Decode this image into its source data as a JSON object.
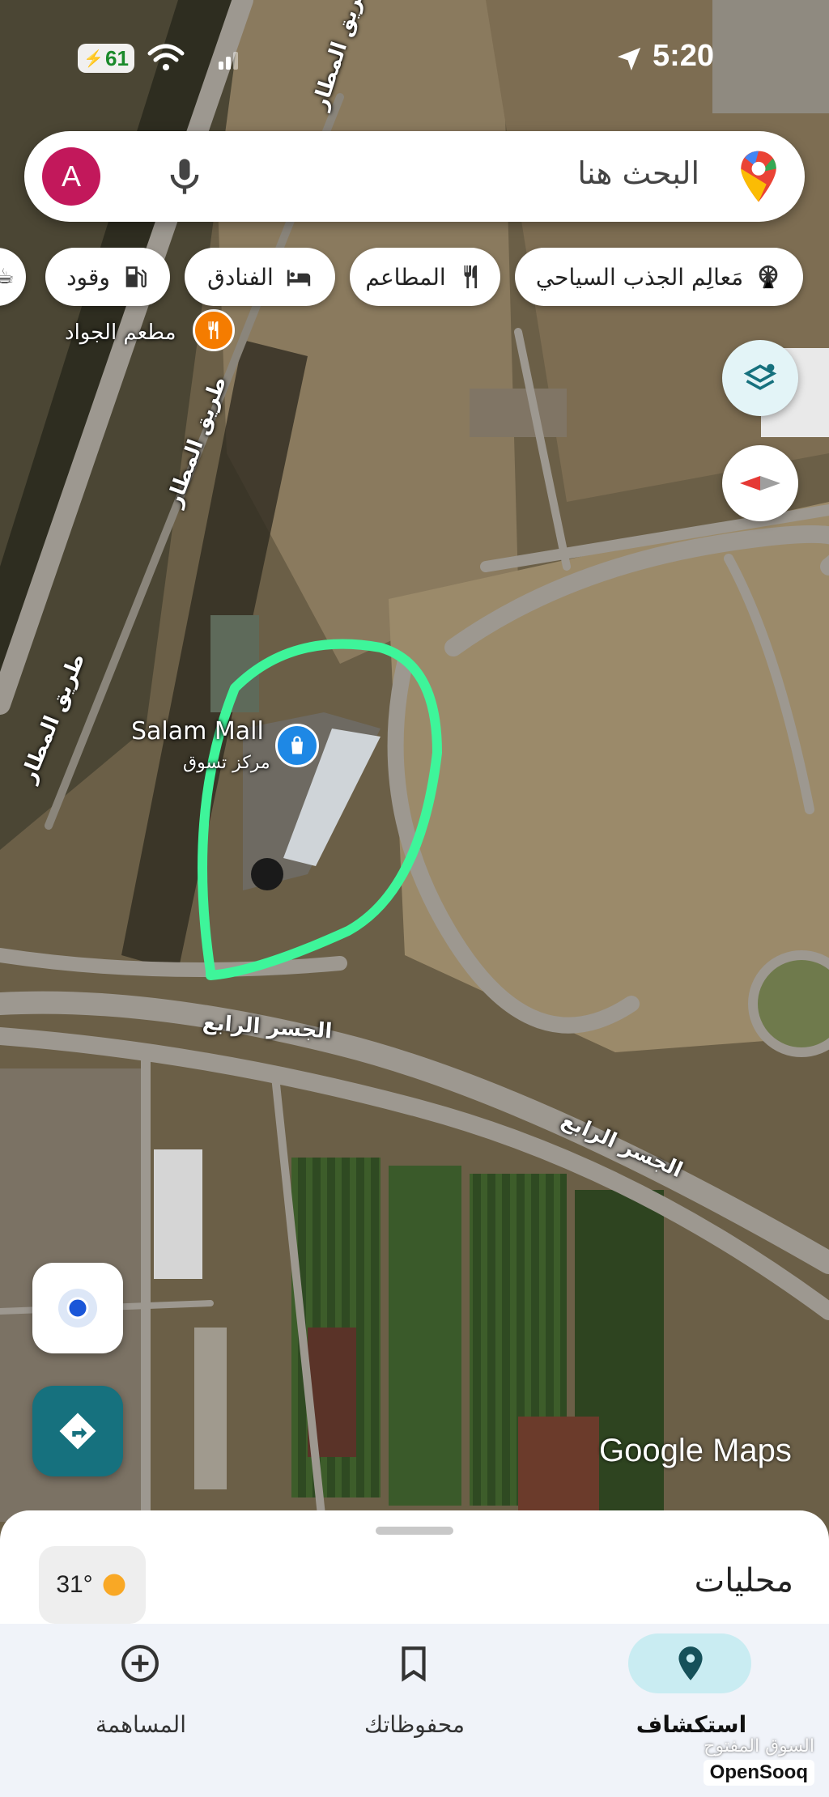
{
  "status_bar": {
    "battery": "61",
    "time": "5:20"
  },
  "search": {
    "placeholder": "البحث هنا",
    "avatar_letter": "A"
  },
  "chips": [
    {
      "label": "مَعالِم الجذب السياحي",
      "icon": "ferris-wheel-icon"
    },
    {
      "label": "المطاعم",
      "icon": "fork-knife-icon"
    },
    {
      "label": "الفنادق",
      "icon": "bed-icon"
    },
    {
      "label": "وقود",
      "icon": "fuel-pump-icon"
    }
  ],
  "map": {
    "labels": {
      "restaurant": "مطعم الجواد",
      "mall_name": "Salam Mall",
      "mall_category": "مركز تسوق",
      "airport_road_1": "طريق المطار",
      "airport_road_2": "طريق المطار",
      "airport_road_3": "طريق المطار",
      "fourth_bridge_1": "الجسر الرابع",
      "fourth_bridge_2": "الجسر الرابع"
    },
    "highlight_color": "#3ef59a",
    "attribution": "Google Maps"
  },
  "sheet": {
    "title": "محليات",
    "weather": "31°"
  },
  "nav": [
    {
      "label": "استكشاف",
      "icon": "location-pin-icon",
      "active": true
    },
    {
      "label": "محفوظاتك",
      "icon": "bookmark-icon",
      "active": false
    },
    {
      "label": "المساهمة",
      "icon": "add-circle-icon",
      "active": false
    }
  ],
  "watermark": {
    "arabic": "السوق المفتوح",
    "brand": "OpenSooq"
  }
}
